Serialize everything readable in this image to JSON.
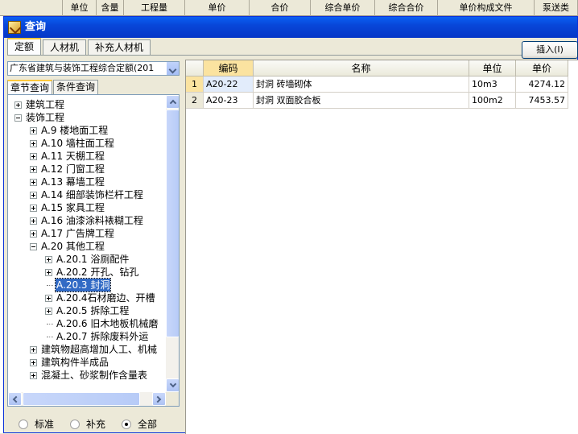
{
  "background_sheet": {
    "columns": [
      "单位",
      "含量",
      "工程量",
      "单价",
      "合价",
      "综合单价",
      "综合合价",
      "单价构成文件",
      "泵送类"
    ]
  },
  "dialog": {
    "title": "查询",
    "top_tabs": [
      "定额",
      "人材机",
      "补充人材机"
    ],
    "active_top_tab": "定额",
    "insert_button": "插入(I)"
  },
  "left_panel": {
    "quota_select_value": "广东省建筑与装饰工程综合定额(201",
    "tabs": [
      "章节查询",
      "条件查询"
    ],
    "active_tab": "章节查询",
    "tree": [
      {
        "label": "建筑工程",
        "toggle": "plus"
      },
      {
        "label": "装饰工程",
        "toggle": "minus"
      },
      {
        "label": "A.9 楼地面工程",
        "toggle": "plus"
      },
      {
        "label": "A.10 墙柱面工程",
        "toggle": "plus"
      },
      {
        "label": "A.11 天棚工程",
        "toggle": "plus"
      },
      {
        "label": "A.12 门窗工程",
        "toggle": "plus"
      },
      {
        "label": "A.13 幕墙工程",
        "toggle": "plus"
      },
      {
        "label": "A.14 细部装饰栏杆工程",
        "toggle": "plus"
      },
      {
        "label": "A.15 家具工程",
        "toggle": "plus"
      },
      {
        "label": "A.16 油漆涂料裱糊工程",
        "toggle": "plus"
      },
      {
        "label": "A.17 广告牌工程",
        "toggle": "plus"
      },
      {
        "label": "A.20 其他工程",
        "toggle": "minus"
      },
      {
        "label": "A.20.1 浴厕配件",
        "toggle": "plus"
      },
      {
        "label": "A.20.2 开孔、钻孔",
        "toggle": "plus"
      },
      {
        "label": "A.20.3 封洞",
        "toggle": "none",
        "selected": true
      },
      {
        "label": "A.20.4石材磨边、开槽",
        "toggle": "plus"
      },
      {
        "label": "A.20.5 拆除工程",
        "toggle": "plus"
      },
      {
        "label": "A.20.6 旧木地板机械磨",
        "toggle": "none"
      },
      {
        "label": "A.20.7 拆除废料外运",
        "toggle": "none"
      },
      {
        "label": "建筑物超高增加人工、机械",
        "toggle": "plus"
      },
      {
        "label": "建筑构件半成品",
        "toggle": "plus"
      },
      {
        "label": "混凝土、砂浆制作含量表",
        "toggle": "plus"
      }
    ],
    "filter_options": [
      "标准",
      "补充",
      "全部"
    ],
    "filter_selected": "全部"
  },
  "grid": {
    "headers": [
      "编码",
      "名称",
      "单位",
      "单价"
    ],
    "rows": [
      {
        "num": "1",
        "code": "A20-22",
        "name": "封洞 砖墙砌体",
        "unit": "10m3",
        "price": "4274.12"
      },
      {
        "num": "2",
        "code": "A20-23",
        "name": "封洞 双面胶合板",
        "unit": "100m2",
        "price": "7453.57"
      }
    ]
  },
  "colors": {
    "titlebar": "#0846d8",
    "selection": "#316ac5",
    "header_highlight": "#fbe3a0",
    "window_bg": "#ece9d8"
  }
}
